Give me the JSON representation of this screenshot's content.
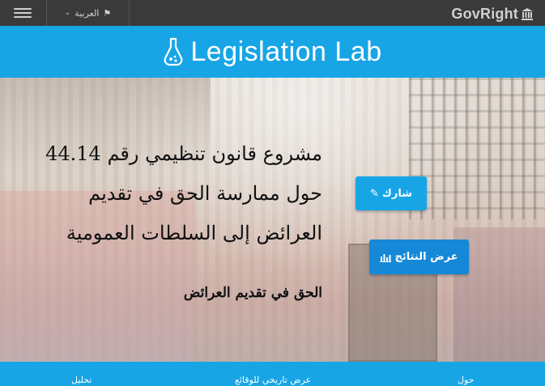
{
  "topbar": {
    "language_label": "العربية",
    "brand_name": "GovRight"
  },
  "header": {
    "app_title": "Legislation Lab"
  },
  "hero": {
    "title_lines": [
      "مشروع قانون تنظيمي رقم 44.14",
      "حول ممارسة الحق في تقديم",
      "العرائض إلى السلطات العمومية"
    ],
    "subtitle": "الحق في تقديم العرائض",
    "share_label": "شارك",
    "results_label": "عرض النتائج"
  },
  "bottom_nav": {
    "about": "حول",
    "timeline": "عرض تاريخي للوقائع",
    "analysis": "تحليل"
  },
  "colors": {
    "accent": "#17a5e6",
    "topbar": "#3a3a3a"
  }
}
